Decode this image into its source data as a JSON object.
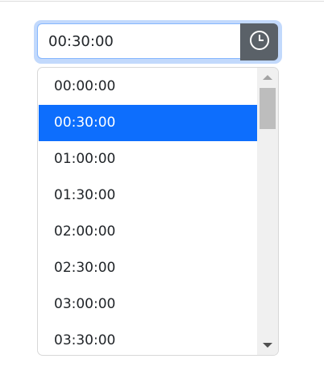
{
  "time_input": {
    "value": "00:30:00",
    "button_icon": "clock-icon"
  },
  "options": [
    "00:00:00",
    "00:30:00",
    "01:00:00",
    "01:30:00",
    "02:00:00",
    "02:30:00",
    "03:00:00",
    "03:30:00"
  ],
  "selected_index": 1,
  "colors": {
    "selected": "#0d6efd",
    "button": "#5a6168",
    "focus_ring": "#c2d9fc"
  }
}
